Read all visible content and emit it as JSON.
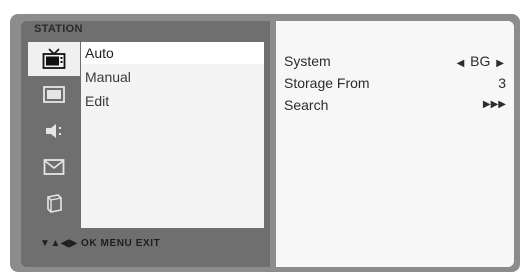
{
  "menu": {
    "title": "STATION",
    "icons": [
      "tv-icon",
      "screen-icon",
      "sound-icon",
      "mail-icon",
      "lock-icon"
    ],
    "items": [
      {
        "label": "Auto",
        "active": true
      },
      {
        "label": "Manual",
        "active": false
      },
      {
        "label": "Edit",
        "active": false
      }
    ],
    "nav_legend": "▼▲◀▶  OK  MENU  EXIT"
  },
  "settings": [
    {
      "label": "System",
      "value": "BG",
      "left_arrow": "◀",
      "right_arrow": "▶"
    },
    {
      "label": "Storage From",
      "value": "3"
    },
    {
      "label": "Search",
      "value": "▶▶▶"
    }
  ]
}
